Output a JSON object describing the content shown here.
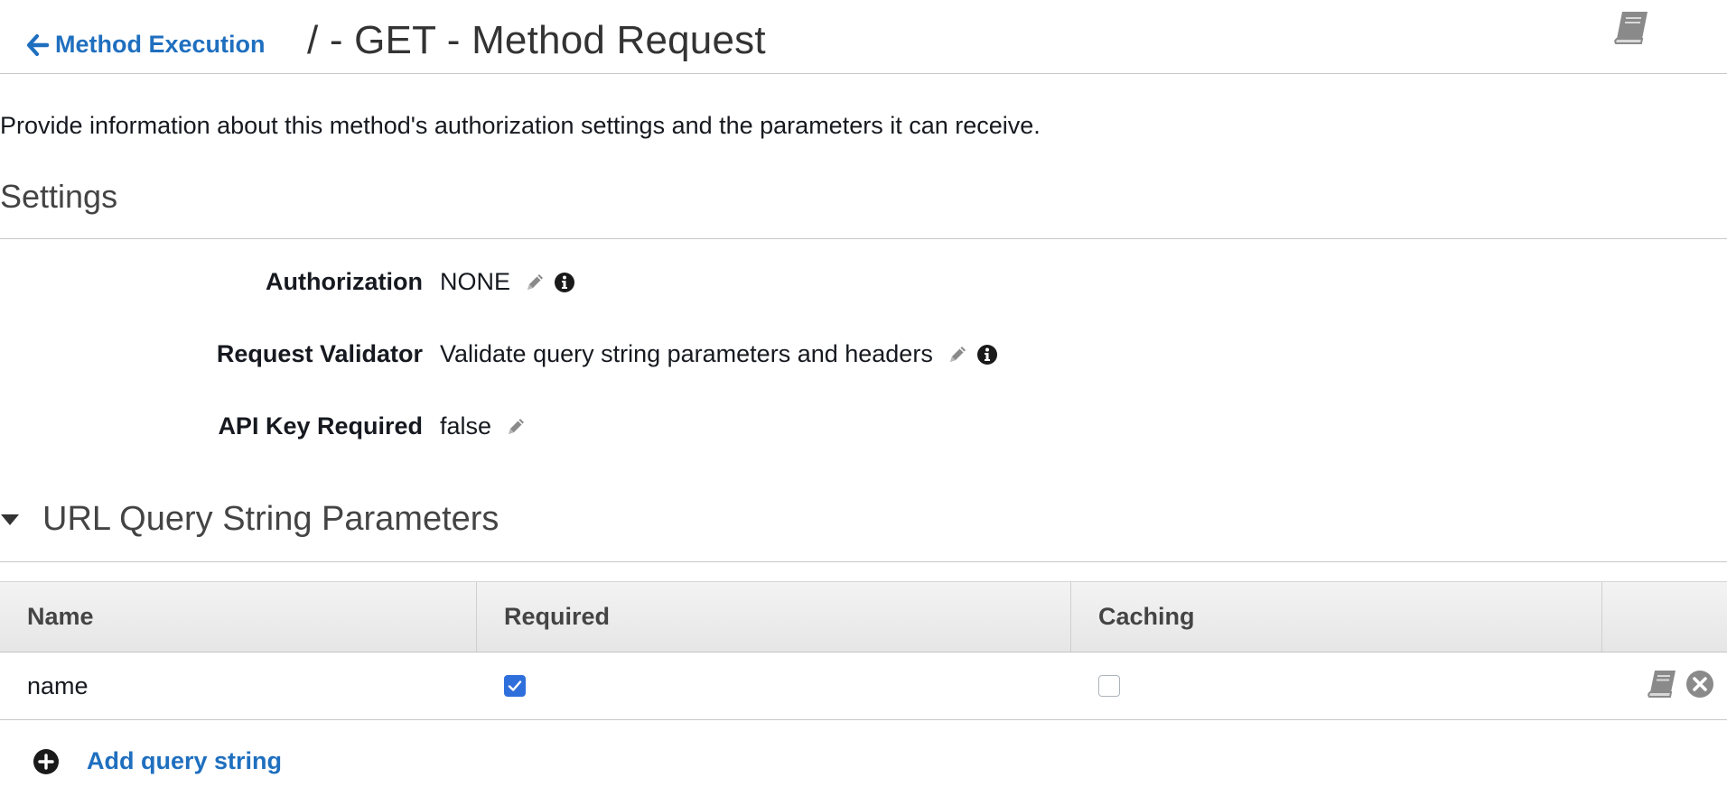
{
  "header": {
    "back_link_label": "Method Execution",
    "title": "/ - GET - Method Request"
  },
  "description": "Provide information about this method's authorization settings and the parameters it can receive.",
  "settings": {
    "title": "Settings",
    "rows": [
      {
        "label": "Authorization",
        "value": "NONE"
      },
      {
        "label": "Request Validator",
        "value": "Validate query string parameters and headers"
      },
      {
        "label": "API Key Required",
        "value": "false"
      }
    ]
  },
  "query_params": {
    "title": "URL Query String Parameters",
    "columns": [
      "Name",
      "Required",
      "Caching"
    ],
    "rows": [
      {
        "name": "name",
        "required": true,
        "caching": false
      }
    ],
    "add_label": "Add query string"
  },
  "icons": {
    "back": "arrow-left-icon",
    "docs": "book-icon",
    "edit": "pencil-icon",
    "info": "info-icon",
    "collapse": "caret-down-icon",
    "remove": "close-circle-icon",
    "add": "plus-circle-icon"
  },
  "colors": {
    "link": "#1f6fbf",
    "checkbox_checked": "#2f6fdc",
    "icon_gray": "#8a8a8a",
    "text": "#16191f"
  }
}
